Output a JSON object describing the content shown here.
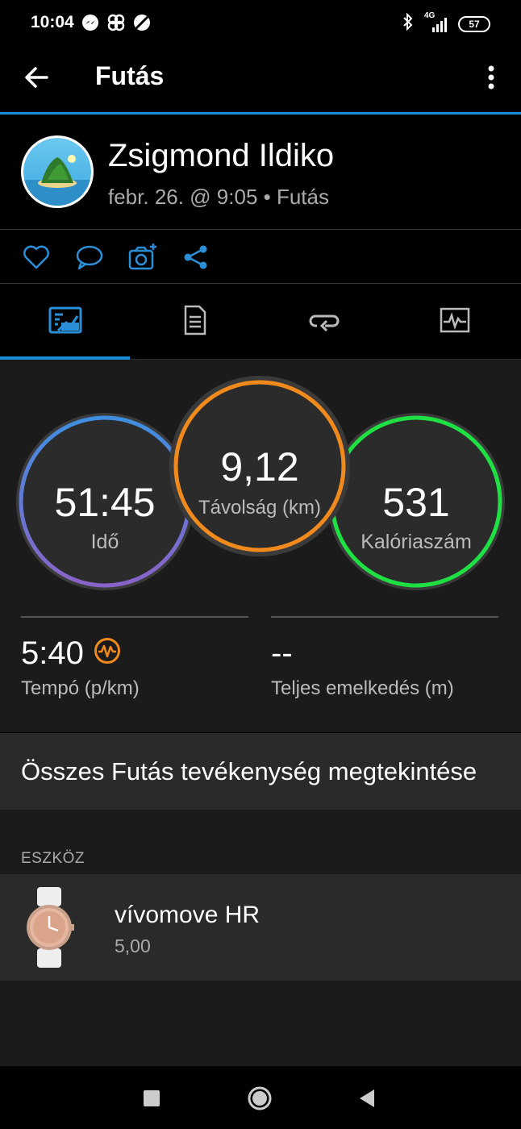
{
  "status_bar": {
    "time": "10:04",
    "network": "4G",
    "battery": "57"
  },
  "app_bar": {
    "title": "Futás",
    "back_icon": "arrow-left-icon",
    "menu_icon": "more-vertical-icon"
  },
  "profile": {
    "name": "Zsigmond Ildiko",
    "subtitle": "febr. 26. @ 9:05 • Futás"
  },
  "actions": [
    {
      "icon": "heart-icon"
    },
    {
      "icon": "comment-icon"
    },
    {
      "icon": "add-photo-icon"
    },
    {
      "icon": "share-icon"
    }
  ],
  "tabs": [
    {
      "icon": "overview-icon",
      "active": true
    },
    {
      "icon": "details-icon",
      "active": false
    },
    {
      "icon": "laps-icon",
      "active": false
    },
    {
      "icon": "chart-icon",
      "active": false
    }
  ],
  "rings": {
    "time": {
      "value": "51:45",
      "label": "Idő"
    },
    "distance": {
      "value": "9,12",
      "label": "Távolság (km)"
    },
    "calories": {
      "value": "531",
      "label": "Kalóriaszám"
    }
  },
  "metrics": {
    "pace": {
      "value": "5:40",
      "label": "Tempó (p/km)"
    },
    "elevation": {
      "value": "--",
      "label": "Teljes emelkedés (m)"
    }
  },
  "view_all": "Összes Futás tevékenység megtekintése",
  "device_section": {
    "label": "ESZKÖZ",
    "name": "vívomove HR",
    "version": "5,00"
  },
  "colors": {
    "accent": "#1a8fd8",
    "ring_time_top": "#3f8fe0",
    "ring_time_bottom": "#8a63c8",
    "ring_distance": "#f08a1c",
    "ring_calories": "#1fe043"
  }
}
